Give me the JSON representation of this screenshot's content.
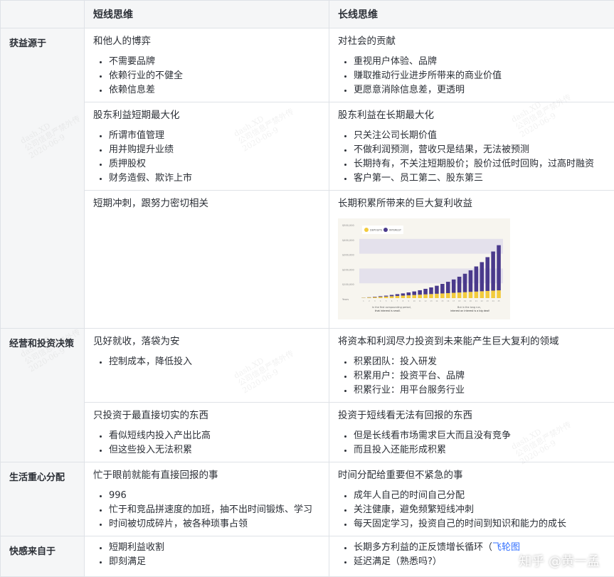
{
  "header": {
    "col1": "",
    "col2": "短线思维",
    "col3": "长线思维"
  },
  "rows": [
    {
      "category": "获益源于",
      "short": {
        "title": "和他人的博弈",
        "items": [
          "不需要品牌",
          "依赖行业的不健全",
          "依赖信息差"
        ]
      },
      "long": {
        "title": "对社会的贡献",
        "items": [
          "重视用户体验、品牌",
          "赚取推动行业进步所带来的商业价值",
          "更愿意消除信息差，更透明"
        ]
      }
    },
    {
      "category": "",
      "short": {
        "title": "股东利益短期最大化",
        "items": [
          "所谓市值管理",
          "用并购提升业绩",
          "质押股权",
          "财务造假、欺诈上市"
        ]
      },
      "long": {
        "title": "股东利益在长期最大化",
        "items": [
          "只关注公司长期价值",
          "不做利润预测，营收只是结果，无法被预测",
          "长期持有，不关注短期股价；股价过低时回购，过高时融资",
          "客户第一、员工第二、股东第三"
        ]
      }
    },
    {
      "category": "",
      "short": {
        "title": "短期冲刺，跟努力密切相关",
        "items": []
      },
      "long": {
        "title": "长期积累所带来的巨大复利收益",
        "items": []
      }
    },
    {
      "category": "经营和投资决策",
      "short": {
        "title": "见好就收，落袋为安",
        "items": [
          "控制成本，降低投入"
        ]
      },
      "long": {
        "title": "将资本和利润尽力投资到未来能产生巨大复利的领域",
        "items": [
          "积累团队：投入研发",
          "积累用户：投资平台、品牌",
          "积累行业：用平台服务行业"
        ]
      }
    },
    {
      "category": "",
      "short": {
        "title": "只投资于最直接切实的东西",
        "items": [
          "看似短线内投入产出比高",
          "但这些投入无法积累"
        ]
      },
      "long": {
        "title": "投资于短线看无法有回报的东西",
        "items": [
          "但是长线看市场需求巨大而且没有竞争",
          "而且投入还能形成积累"
        ]
      }
    },
    {
      "category": "生活重心分配",
      "short": {
        "title": "忙于眼前就能有直接回报的事",
        "items": [
          "996",
          "忙于和竞品拼速度的加班，抽不出时间锻炼、学习",
          "时间被切成碎片，被各种琐事占领"
        ]
      },
      "long": {
        "title": "时间分配给重要但不紧急的事",
        "items": [
          "成年人自己的时间自己分配",
          "关注健康，避免频繁短线冲刺",
          "每天固定学习，投资自己的时间到知识和能力的成长"
        ]
      }
    },
    {
      "category": "快感来自于",
      "short": {
        "title": "",
        "items": [
          "短期利益收割",
          "即刻满足"
        ]
      },
      "long": {
        "title": "",
        "items": [
          "长期多方利益的正反馈增长循环（",
          "延迟满足（熟悉吗?）"
        ],
        "link_text": "飞轮图"
      }
    }
  ],
  "chart_data": {
    "type": "bar",
    "legend": [
      "DEPOSITS",
      "INTEREST"
    ],
    "colors": {
      "deposits": "#f2cb3d",
      "interest": "#4a3a8c",
      "background": "#f7f5ef",
      "band": "#e4e1ec"
    },
    "ylabels": [
      "$500,000",
      "$400,000",
      "$300,000",
      "$200,000",
      "$100,000",
      "Years"
    ],
    "categories": [
      "1",
      "2",
      "3",
      "4",
      "5",
      "6",
      "7",
      "8",
      "9",
      "10",
      "11",
      "12",
      "13",
      "14",
      "15",
      "16",
      "17",
      "18",
      "19",
      "20",
      "21",
      "22",
      "23",
      "24",
      "25"
    ],
    "series": [
      {
        "name": "DEPOSITS",
        "values": [
          4,
          8,
          12,
          16,
          20,
          24,
          28,
          32,
          36,
          40,
          44,
          48,
          52,
          56,
          60,
          64,
          68,
          72,
          76,
          80,
          84,
          88,
          92,
          96,
          100
        ]
      },
      {
        "name": "INTEREST",
        "values": [
          0.5,
          1,
          2,
          3,
          4,
          6,
          8,
          10,
          13,
          16,
          20,
          25,
          30,
          36,
          43,
          51,
          60,
          71,
          83,
          97,
          113,
          131,
          152,
          176,
          203
        ]
      }
    ],
    "ylim": [
      0,
      320
    ],
    "caption_left": [
      "In the first compounding period,",
      "that interest is small."
    ],
    "caption_right": [
      "But in the long run,",
      "interest on interest is a big deal!"
    ]
  },
  "watermark": {
    "lines": [
      "dash.XD",
      "公司信息严禁外传",
      "2020-06-9"
    ]
  },
  "credit": "知乎 @黄一孟"
}
